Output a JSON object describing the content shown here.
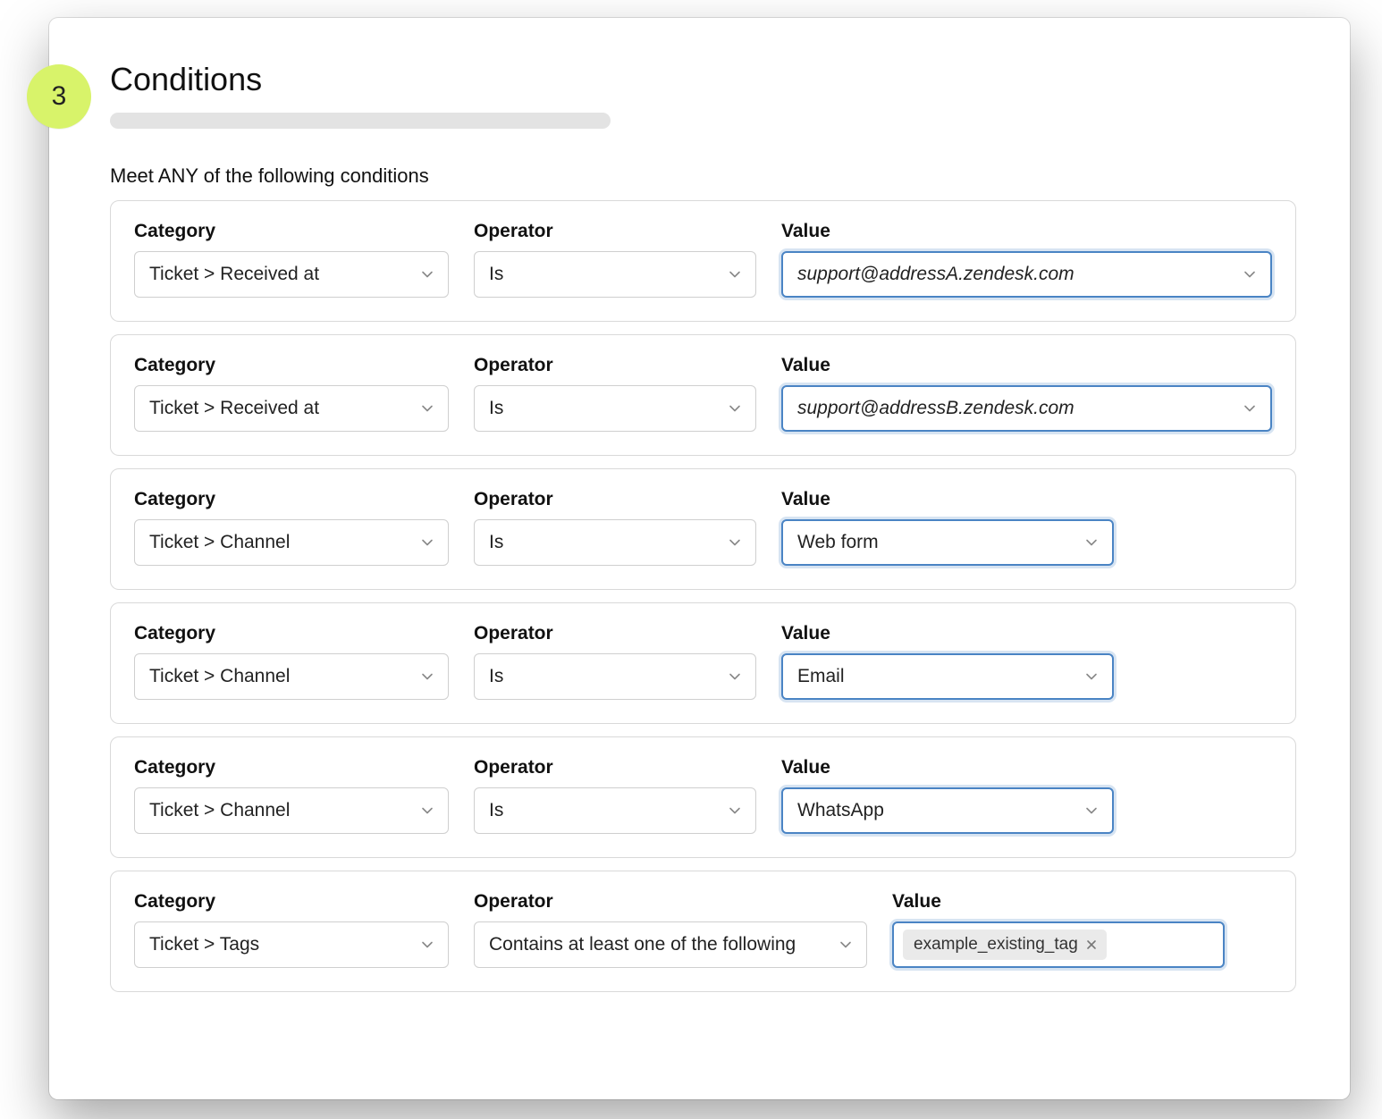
{
  "step_number": "3",
  "title": "Conditions",
  "subtitle": "Meet ANY of the following conditions",
  "labels": {
    "category": "Category",
    "operator": "Operator",
    "value": "Value"
  },
  "rows": [
    {
      "category": "Ticket > Received at",
      "operator": "Is",
      "value": "support@addressA.zendesk.com",
      "value_italic": true,
      "wide_op": false
    },
    {
      "category": "Ticket > Received at",
      "operator": "Is",
      "value": "support@addressB.zendesk.com",
      "value_italic": true,
      "wide_op": false
    },
    {
      "category": "Ticket > Channel",
      "operator": "Is",
      "value": "Web form",
      "value_italic": false,
      "wide_op": false
    },
    {
      "category": "Ticket > Channel",
      "operator": "Is",
      "value": "Email",
      "value_italic": false,
      "wide_op": false
    },
    {
      "category": "Ticket > Channel",
      "operator": "Is",
      "value": "WhatsApp",
      "value_italic": false,
      "wide_op": false
    }
  ],
  "tag_row": {
    "category": "Ticket > Tags",
    "operator": "Contains at least one of the following",
    "tag": "example_existing_tag"
  }
}
